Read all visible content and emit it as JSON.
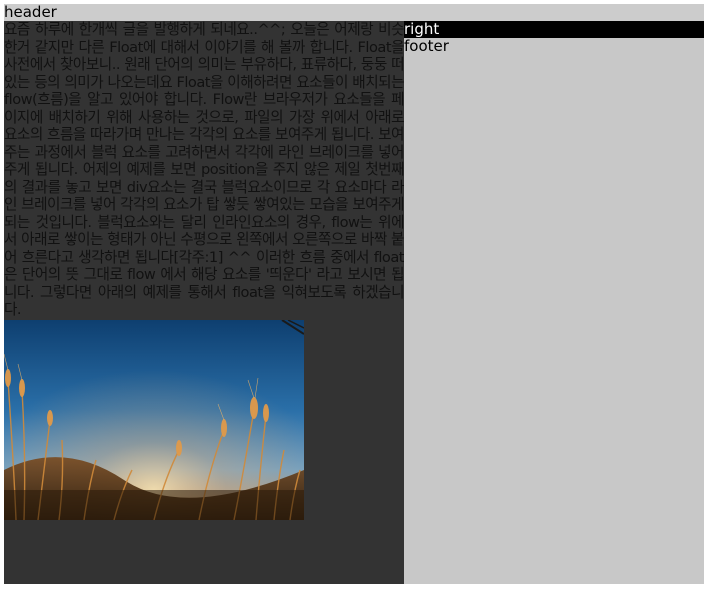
{
  "header": {
    "label": "header"
  },
  "content": {
    "article": "요즘 하루에 한개씩 글을 발행하게 되네요..^^; 오늘은 어제랑 비슷한거 같지만 다른 Float에 대해서 이야기를 해 볼까 합니다. Float을 사전에서 찾아보니.. 원래 단어의 의미는 부유하다, 표류하다, 둥둥 떠있는 등의 의미가 나오는데요 Float을 이해하려면 요소들이 배치되는 flow(흐름)을 알고 있어야 합니다. Flow란 브라우저가 요소들을 페이지에 배치하기 위해 사용하는 것으로, 파일의 가장 위에서 아래로 요소의 흐름을 따라가며 만나는 각각의 요소를 보여주게 됩니다. 보여주는 과정에서 블럭 요소를 고려하면서 각각에 라인 브레이크를 넣어주게 됩니다. 어제의 예제를 보면 position을 주지 않은 제일 첫번째의 결과를 놓고 보면 div요소는 결국 블럭요소이므로 각 요소마다 라인 브레이크를 넣어 각각의 요소가 탑 쌓듯 쌓여있는 모습을 보여주게 되는 것입니다. 블럭요소와는 달리 인라인요소의 경우, flow는 위에서 아래로 쌓이는 형태가 아닌 수평으로 왼쪽에서 오른쪽으로 바짝 붙어 흐른다고 생각하면 됩니다[각주:1] ^^ 이러한 흐름 중에서 float은 단어의 뜻 그대로 flow 에서 해당 요소를 '띄운다' 라고 보시면 됩니다. 그렇다면 아래의 예제를 통해서 float을 익혀보도록 하겠습니다."
  },
  "sidebar": {
    "label": "right"
  },
  "footer": {
    "label": "footer"
  },
  "colors": {
    "header_bg": "#cccccc",
    "content_bg": "#333333",
    "sidebar_bg": "#c8c8c8",
    "sidebar_title_bg": "#000000"
  }
}
